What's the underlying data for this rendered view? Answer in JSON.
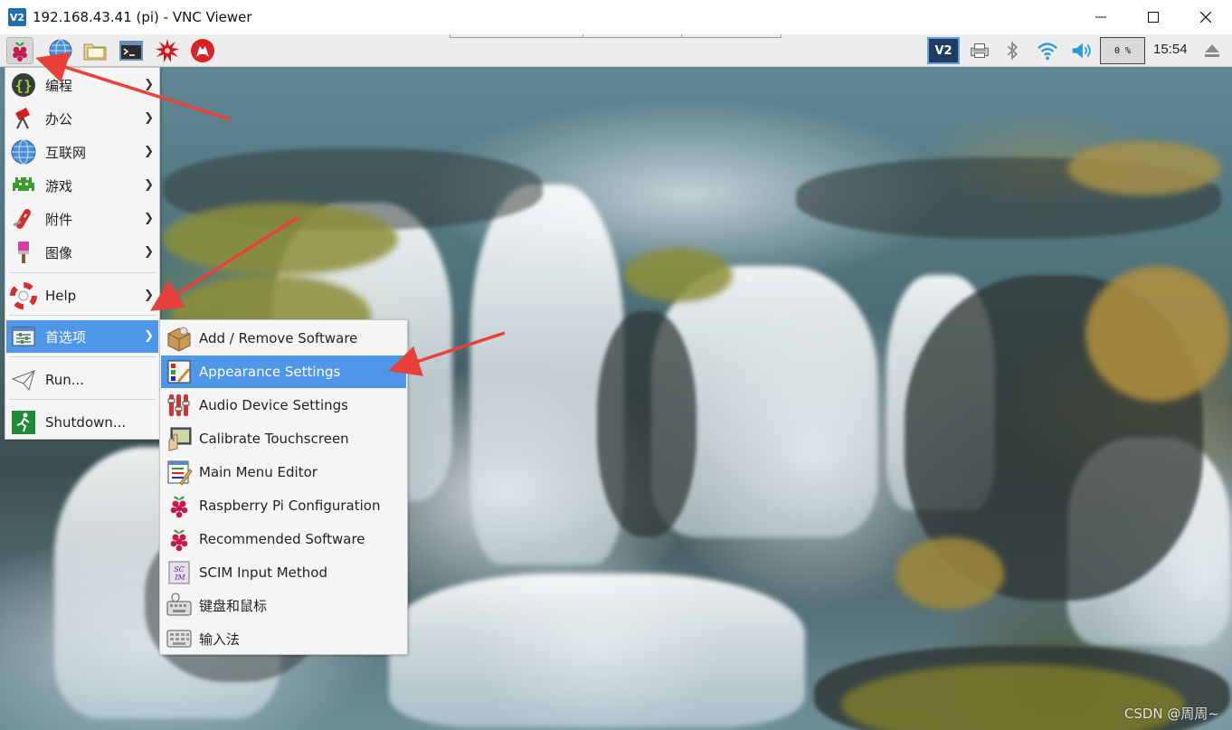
{
  "window": {
    "title": "192.168.43.41 (pi) - VNC Viewer",
    "app_icon_text": "V2"
  },
  "taskbar": {
    "cpu_usage": "0 %",
    "clock": "15:54",
    "vnc_icon_text": "V2"
  },
  "main_menu": {
    "items": [
      {
        "label": "编程",
        "icon": "programming-icon",
        "submenu": true
      },
      {
        "label": "办公",
        "icon": "office-icon",
        "submenu": true
      },
      {
        "label": "互联网",
        "icon": "internet-globe-icon",
        "submenu": true
      },
      {
        "label": "游戏",
        "icon": "games-alien-icon",
        "submenu": true
      },
      {
        "label": "附件",
        "icon": "accessories-knife-icon",
        "submenu": true
      },
      {
        "label": "图像",
        "icon": "graphics-brush-icon",
        "submenu": true
      },
      {
        "label": "Help",
        "icon": "help-lifebuoy-icon",
        "submenu": true
      },
      {
        "label": "首选项",
        "icon": "preferences-icon",
        "submenu": true
      },
      {
        "label": "Run...",
        "icon": "run-paperplane-icon",
        "submenu": false
      },
      {
        "label": "Shutdown...",
        "icon": "shutdown-exit-icon",
        "submenu": false
      }
    ]
  },
  "sub_menu": {
    "items": [
      {
        "label": "Add / Remove Software",
        "icon": "package-icon"
      },
      {
        "label": "Appearance Settings",
        "icon": "appearance-icon"
      },
      {
        "label": "Audio Device Settings",
        "icon": "audio-mixer-icon"
      },
      {
        "label": "Calibrate Touchscreen",
        "icon": "touchscreen-icon"
      },
      {
        "label": "Main Menu Editor",
        "icon": "menu-editor-icon"
      },
      {
        "label": "Raspberry Pi Configuration",
        "icon": "raspberry-icon"
      },
      {
        "label": "Recommended Software",
        "icon": "raspberry-icon"
      },
      {
        "label": "SCIM Input Method",
        "icon": "scim-icon"
      },
      {
        "label": "键盘和鼠标",
        "icon": "keyboard-mouse-icon"
      },
      {
        "label": "输入法",
        "icon": "input-method-keyboard-icon"
      }
    ]
  },
  "watermark": "CSDN @周周~",
  "colors": {
    "highlight": "#4d96e8",
    "annotation_arrow": "#e8403a",
    "menu_bg": "#f5f5f5"
  }
}
